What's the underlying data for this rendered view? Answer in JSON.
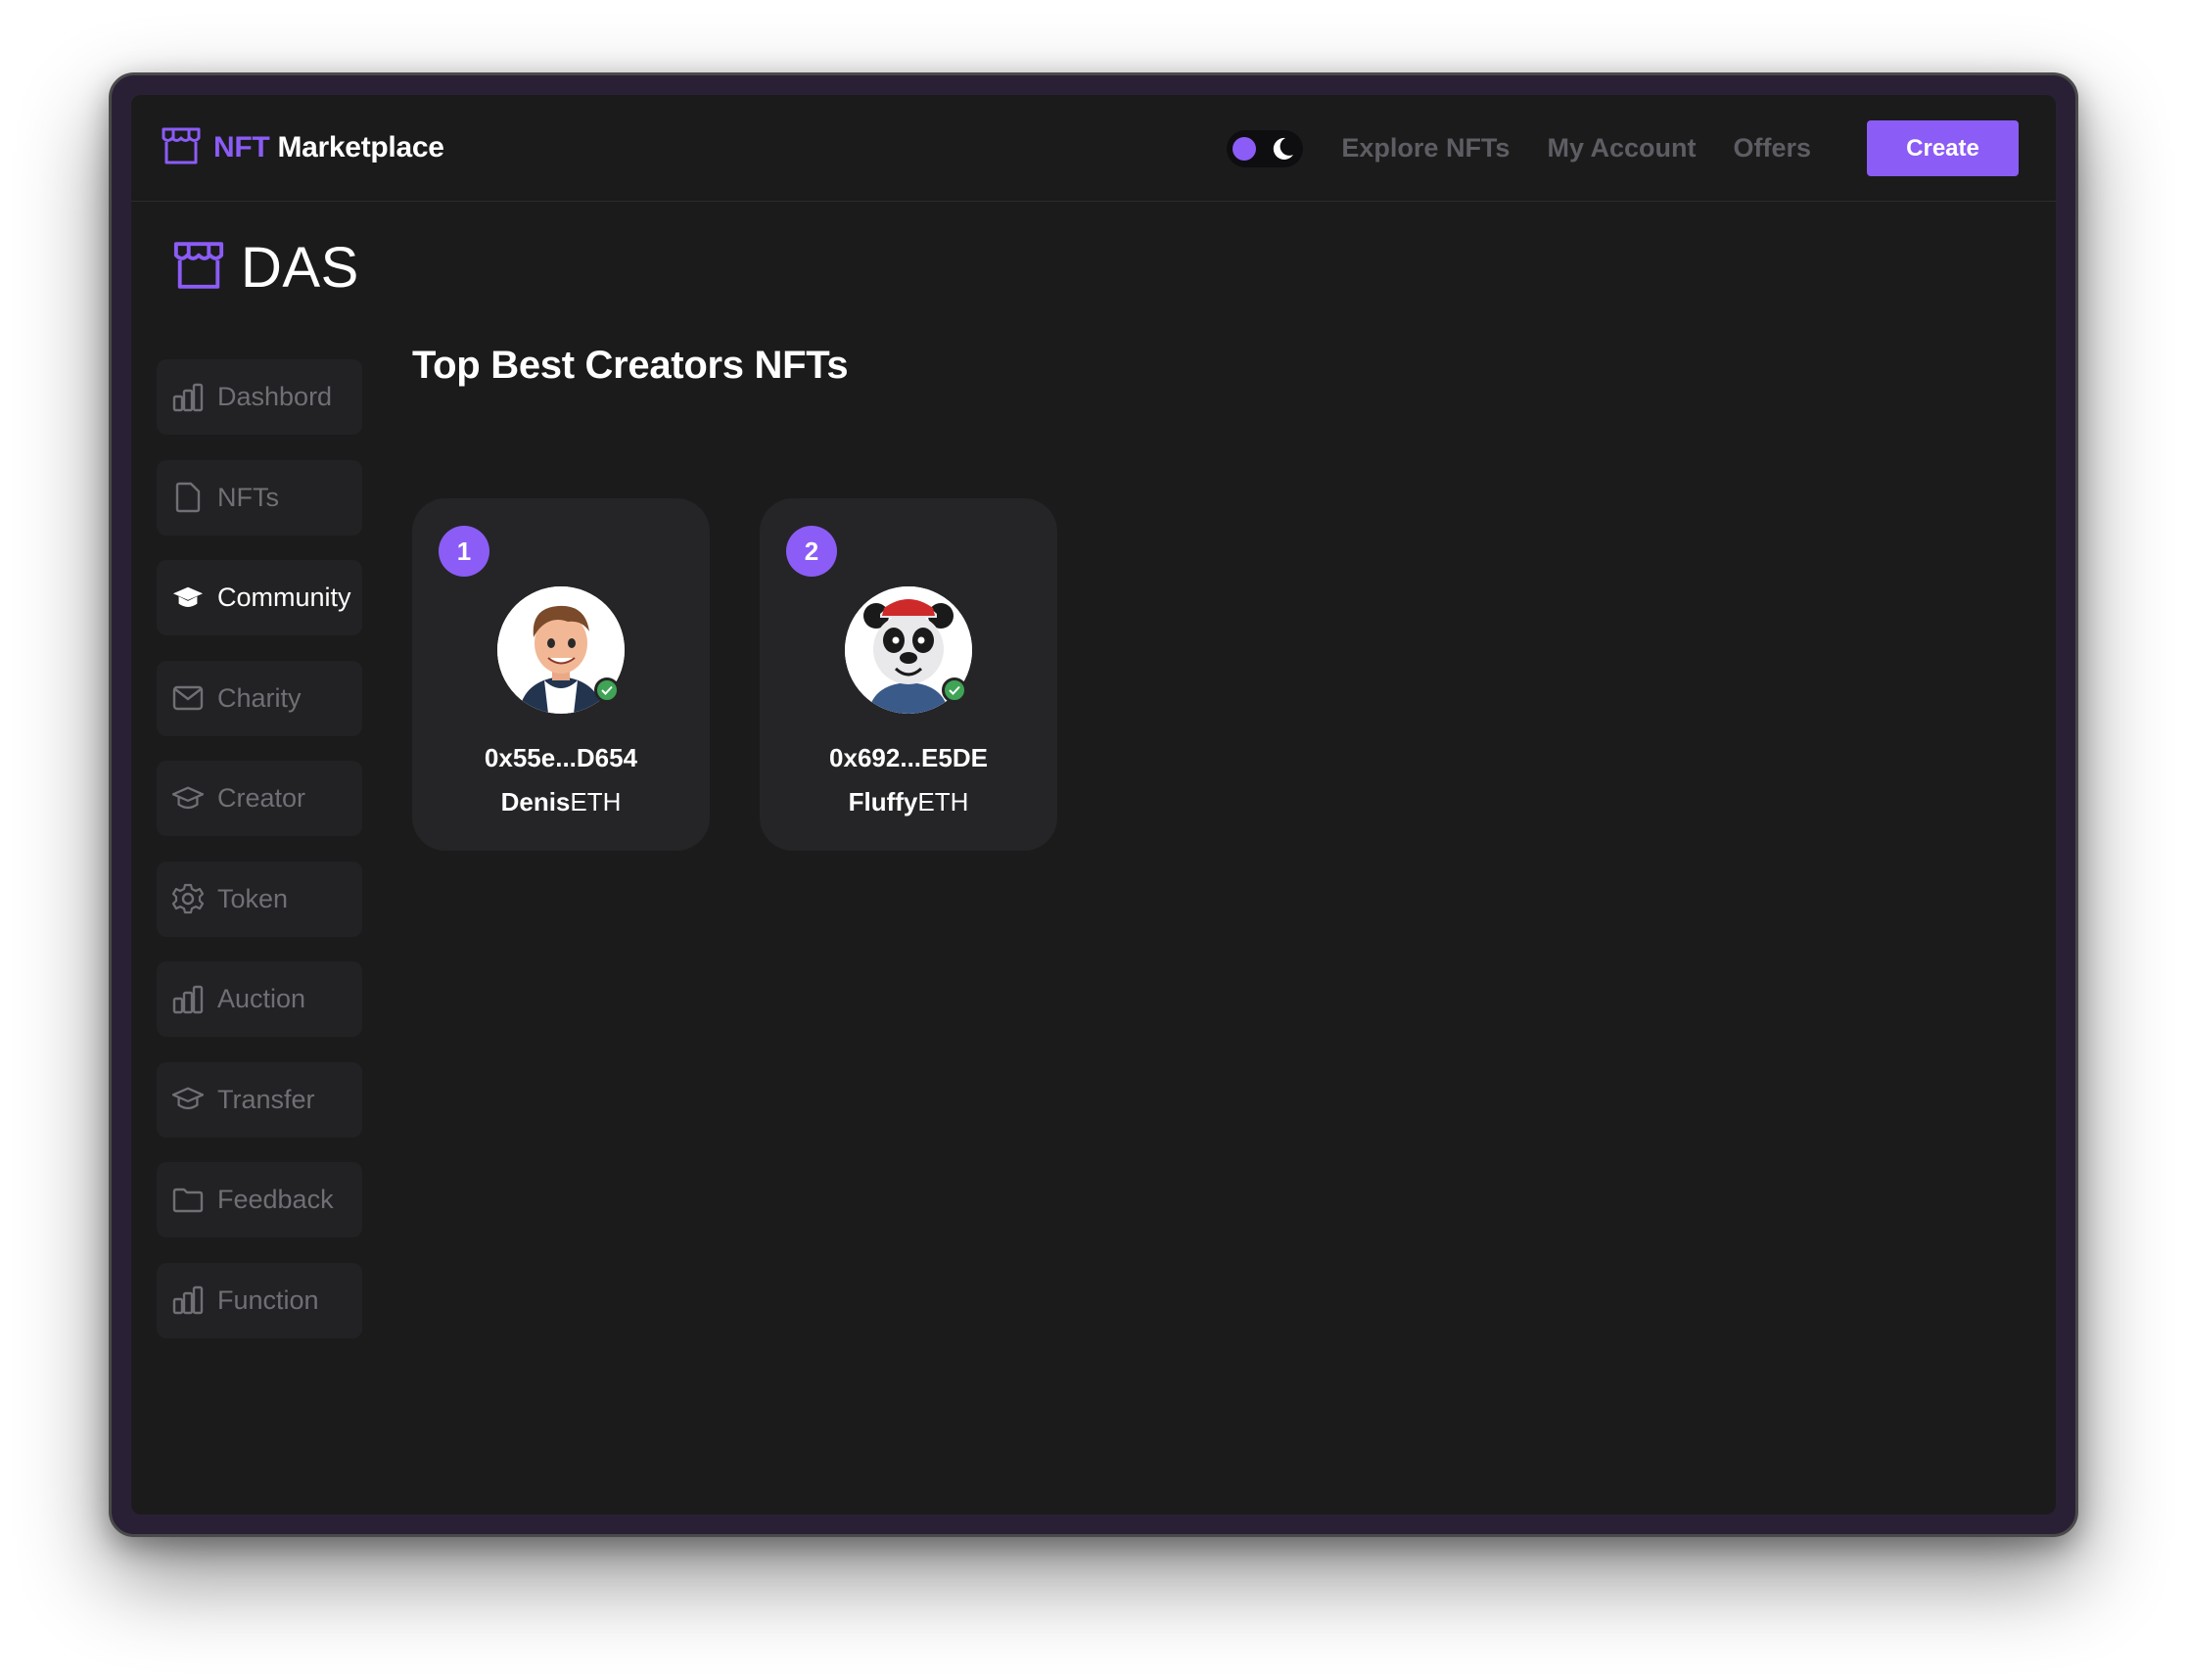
{
  "header": {
    "brand_prefix": "NFT",
    "brand_name": "Marketplace",
    "nav": [
      "Explore NFTs",
      "My Account",
      "Offers"
    ],
    "create_label": "Create",
    "theme_toggle": "dark-mode"
  },
  "logo": {
    "title": "DAS"
  },
  "sidebar": {
    "items": [
      {
        "label": "Dashbord",
        "icon": "bar-chart-icon",
        "active": false
      },
      {
        "label": "NFTs",
        "icon": "file-icon",
        "active": false
      },
      {
        "label": "Community",
        "icon": "graduation-cap-icon",
        "active": true
      },
      {
        "label": "Charity",
        "icon": "mail-icon",
        "active": false
      },
      {
        "label": "Creator",
        "icon": "graduation-cap-icon",
        "active": false
      },
      {
        "label": "Token",
        "icon": "gear-icon",
        "active": false
      },
      {
        "label": "Auction",
        "icon": "bar-chart-icon",
        "active": false
      },
      {
        "label": "Transfer",
        "icon": "graduation-cap-icon",
        "active": false
      },
      {
        "label": "Feedback",
        "icon": "folder-icon",
        "active": false
      },
      {
        "label": "Function",
        "icon": "bar-chart-icon",
        "active": false
      }
    ]
  },
  "main": {
    "title": "Top Best Creators NFTs",
    "creators": [
      {
        "rank": "1",
        "address": "0x55e...D654",
        "name": "Denis",
        "suffix": "ETH",
        "verified": true,
        "avatar": "cartoon-boy-avatar"
      },
      {
        "rank": "2",
        "address": "0x692...E5DE",
        "name": "Fluffy",
        "suffix": "ETH",
        "verified": true,
        "avatar": "cartoon-panda-avatar"
      }
    ]
  },
  "colors": {
    "accent": "#8b5cf6",
    "background": "#1b1b1c",
    "card": "#252527",
    "verified": "#3fa455"
  }
}
